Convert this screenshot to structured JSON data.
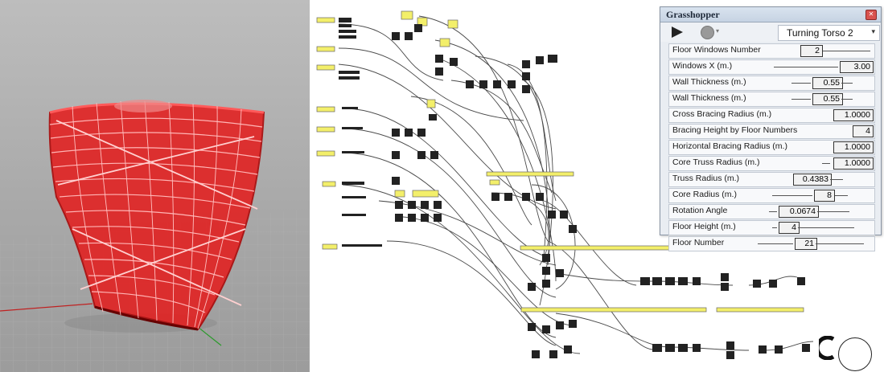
{
  "rhino_viewport": {
    "model": "twisting-tower-mesh",
    "accent": "#e51a1a"
  },
  "grasshopper_canvas": {
    "wire_color": "#4a4a4a",
    "panel_color": "#f3ef6a"
  },
  "remote_panel": {
    "title": "Grasshopper",
    "preset": "Turning Torso 2",
    "sliders": [
      {
        "label": "Floor Windows Number",
        "value": "2"
      },
      {
        "label": "Windows X (m.)",
        "value": "3.00"
      },
      {
        "label": "Wall Thickness (m.)",
        "value": "0.55"
      },
      {
        "label": "Wall Thickness (m.)",
        "value": "0.55"
      },
      {
        "label": "Cross Bracing Radius (m.)",
        "value": "1.0000"
      },
      {
        "label": "Bracing Height by Floor Numbers",
        "value": "4"
      },
      {
        "label": "Horizontal Bracing Radius (m.)",
        "value": "1.0000"
      },
      {
        "label": "Core Truss Radius (m.)",
        "value": "1.0000"
      },
      {
        "label": "Truss Radius (m.)",
        "value": "0.4383"
      },
      {
        "label": "Core Radius (m.)",
        "value": "8"
      },
      {
        "label": "Rotation Angle",
        "value": "0.0674"
      },
      {
        "label": "Floor Height (m.)",
        "value": "4"
      },
      {
        "label": "Floor Number",
        "value": "21"
      }
    ]
  }
}
